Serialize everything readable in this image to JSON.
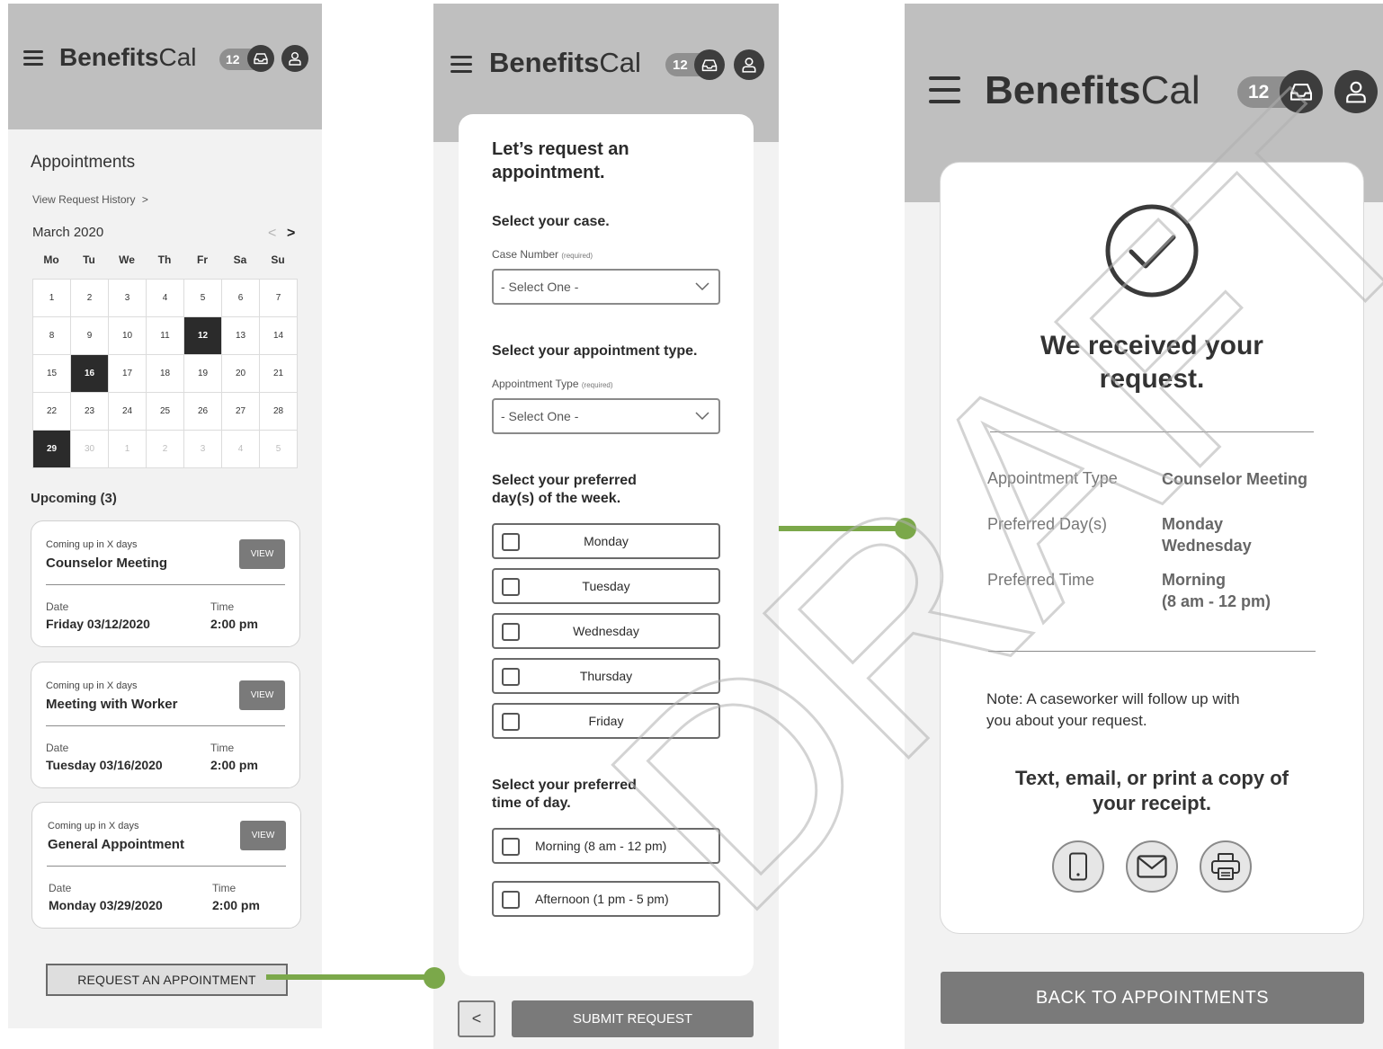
{
  "brand": {
    "bold": "Benefits",
    "regular": "Cal",
    "badge_count": "12"
  },
  "icons": {
    "menu": "hamburger-menu-icon",
    "inbox": "inbox-icon",
    "profile": "user-icon",
    "check": "check-circle-icon",
    "phone": "phone-icon",
    "email": "email-icon",
    "print": "printer-icon"
  },
  "colors": {
    "header": "#bfbfbf",
    "accent_connector": "#7ba84a",
    "button_dark": "#7a7a7a",
    "selected_day": "#2b2b2b"
  },
  "appointments_screen": {
    "title": "Appointments",
    "history_link": "View Request History",
    "history_chevron": ">",
    "month": "March 2020",
    "nav_prev": "<",
    "nav_next": ">",
    "weekdays": [
      "Mo",
      "Tu",
      "We",
      "Th",
      "Fr",
      "Sa",
      "Su"
    ],
    "weeks": [
      [
        "1",
        "2",
        "3",
        "4",
        "5",
        "6",
        "7"
      ],
      [
        "8",
        "9",
        "10",
        "11",
        "12",
        "13",
        "14"
      ],
      [
        "15",
        "16",
        "17",
        "18",
        "19",
        "20",
        "21"
      ],
      [
        "22",
        "23",
        "24",
        "25",
        "26",
        "27",
        "28"
      ],
      [
        "29",
        "30",
        "1",
        "2",
        "3",
        "4",
        "5"
      ]
    ],
    "selected_days": [
      "12",
      "16",
      "29"
    ],
    "upcoming_label": "Upcoming (3)",
    "cards": [
      {
        "coming": "Coming up in X days",
        "name": "Counselor Meeting",
        "view": "VIEW",
        "date_label": "Date",
        "date": "Friday 03/12/2020",
        "time_label": "Time",
        "time": "2:00 pm"
      },
      {
        "coming": "Coming up in X days",
        "name": "Meeting with Worker",
        "view": "VIEW",
        "date_label": "Date",
        "date": "Tuesday 03/16/2020",
        "time_label": "Time",
        "time": "2:00 pm"
      },
      {
        "coming": "Coming up in X days",
        "name": "General Appointment",
        "view": "VIEW",
        "date_label": "Date",
        "date": "Monday 03/29/2020",
        "time_label": "Time",
        "time": "2:00 pm"
      }
    ],
    "request_button": "REQUEST AN APPOINTMENT"
  },
  "request_screen": {
    "heading_line1": "Let’s request an",
    "heading_line2": "appointment.",
    "case_heading": "Select your case.",
    "case_label": "Case Number",
    "case_required": "(required)",
    "case_select": "- Select One -",
    "type_heading": "Select your appointment type.",
    "type_label": "Appointment Type",
    "type_required": "(required)",
    "type_select": "- Select One -",
    "days_heading_line1": "Select your preferred",
    "days_heading_line2": "day(s) of the week.",
    "days": [
      "Monday",
      "Tuesday",
      "Wednesday",
      "Thursday",
      "Friday"
    ],
    "time_heading_line1": "Select your preferred",
    "time_heading_line2": "time of day.",
    "times": [
      "Morning (8 am - 12 pm)",
      "Afternoon (1 pm - 5 pm)"
    ],
    "back_glyph": "<",
    "submit": "SUBMIT REQUEST"
  },
  "confirmation_screen": {
    "title_line1": "We received your",
    "title_line2": "request.",
    "rows": [
      {
        "key": "Appointment Type",
        "value_lines": [
          "Counselor Meeting"
        ]
      },
      {
        "key": "Preferred Day(s)",
        "value_lines": [
          "Monday",
          "Wednesday"
        ]
      },
      {
        "key": "Preferred Time",
        "value_lines": [
          "Morning",
          "(8 am  - 12 pm)"
        ]
      }
    ],
    "note_line1": "Note: A caseworker will follow up with",
    "note_line2": "you about your request.",
    "share_line1": "Text, email, or print a copy of",
    "share_line2": "your receipt.",
    "back_button": "BACK TO APPOINTMENTS"
  },
  "watermark": "DRAFT"
}
